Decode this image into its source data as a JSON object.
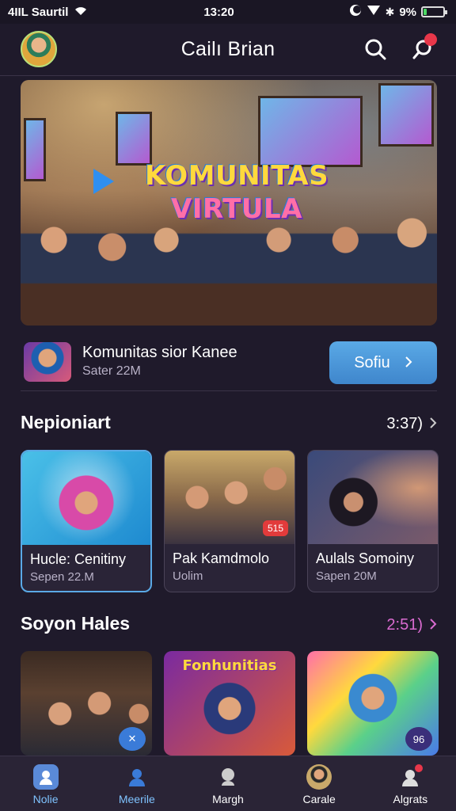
{
  "status_bar": {
    "carrier": "4IIL Saurtil",
    "time": "13:20",
    "battery": "9%",
    "battery_level": 0.15
  },
  "header": {
    "title": "Cailı Brian"
  },
  "hero": {
    "title_line1": "KOMUNITAS",
    "title_line2": "VIRTULA"
  },
  "community": {
    "name": "Komunitas sior Kanee",
    "subtitle": "Sater 22M",
    "button_label": "Sofiu"
  },
  "section1": {
    "title": "Nepioniart",
    "more_label": "3:37)",
    "cards": [
      {
        "title": "Hucle: Cenitiny",
        "subtitle": "Sepen 22.M"
      },
      {
        "title": "Pak Kamdmolo",
        "subtitle": "Uolim",
        "badge": "515"
      },
      {
        "title": "Aulals Somoiny",
        "subtitle": "Sapen 20M"
      }
    ]
  },
  "section2": {
    "title": "Soyon Hales",
    "more_label": "2:51)",
    "cards": [
      {
        "text": ""
      },
      {
        "text": "Fonhunitias"
      },
      {
        "badge": "96"
      }
    ]
  },
  "bottom_nav": [
    {
      "label": "Nolie",
      "icon": "profile-icon",
      "active": true
    },
    {
      "label": "Meerile",
      "icon": "user-icon",
      "active": false
    },
    {
      "label": "Margh",
      "icon": "chat-icon",
      "active": false
    },
    {
      "label": "Carale",
      "icon": "avatar-icon",
      "active": false
    },
    {
      "label": "Algrats",
      "icon": "notifications-icon",
      "active": false
    }
  ],
  "colors": {
    "background": "#1f1a2b",
    "accent": "#5aa9e6",
    "section2_more": "#d96bd0",
    "notification": "#e8374a"
  }
}
